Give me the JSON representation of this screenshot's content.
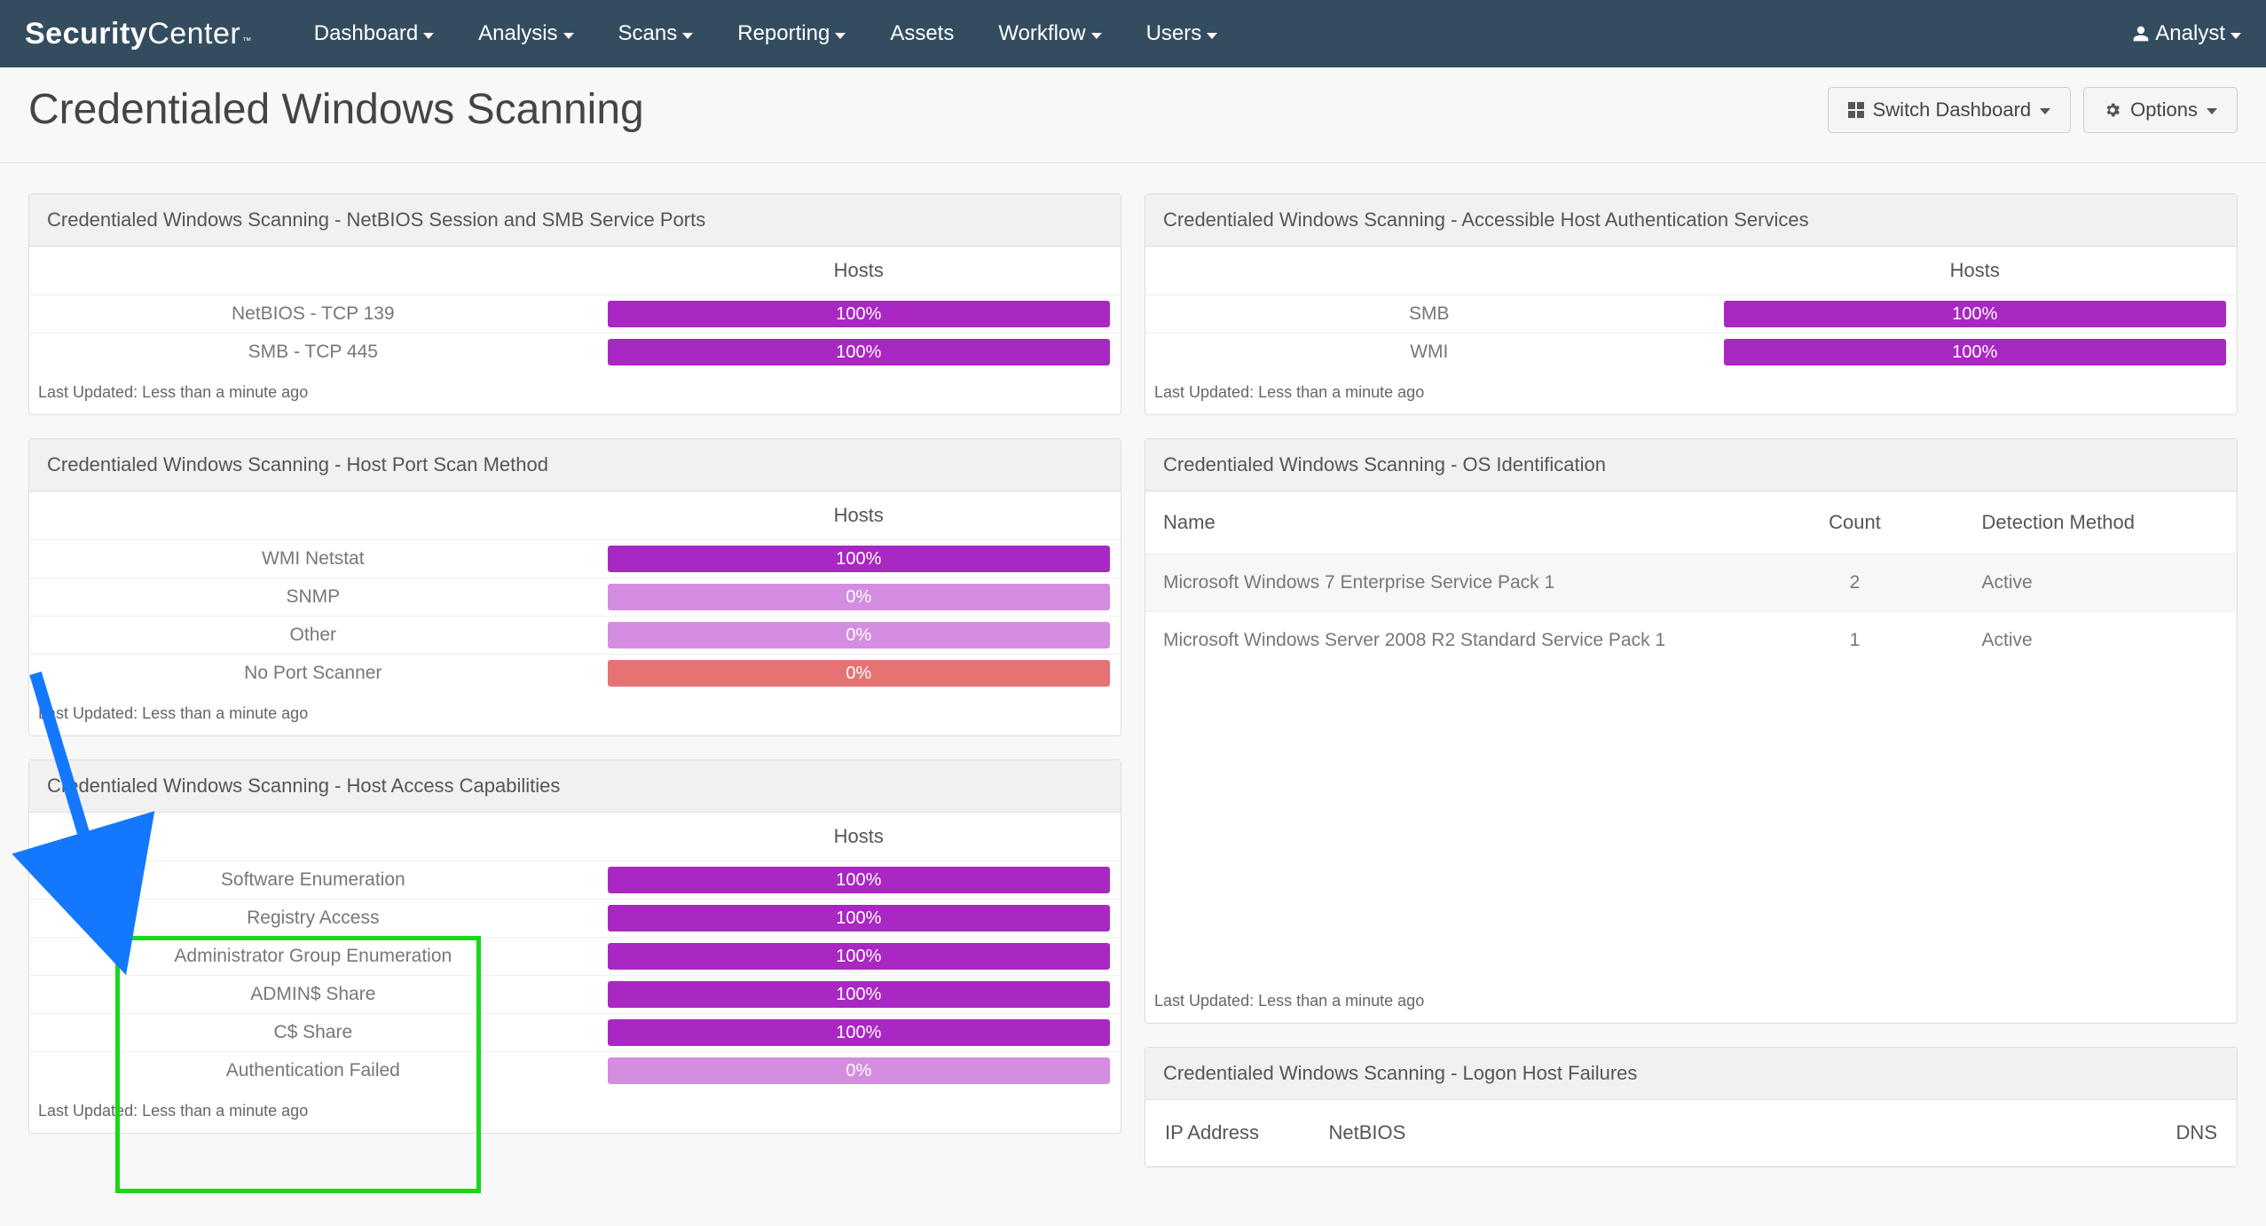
{
  "brand": {
    "part1": "Security",
    "part2": "Center",
    "tm": "™"
  },
  "nav": {
    "items": [
      {
        "label": "Dashboard",
        "caret": true
      },
      {
        "label": "Analysis",
        "caret": true
      },
      {
        "label": "Scans",
        "caret": true
      },
      {
        "label": "Reporting",
        "caret": true
      },
      {
        "label": "Assets",
        "caret": false
      },
      {
        "label": "Workflow",
        "caret": true
      },
      {
        "label": "Users",
        "caret": true
      }
    ],
    "userLabel": "Analyst"
  },
  "page": {
    "title": "Credentialed Windows Scanning",
    "switchBtn": "Switch Dashboard",
    "optionsBtn": "Options"
  },
  "footerText": "Last Updated: Less than a minute ago",
  "panels": {
    "netbios": {
      "title": "Credentialed Windows Scanning - NetBIOS Session and SMB Service Ports",
      "col": "Hosts",
      "rows": [
        {
          "label": "NetBIOS - TCP 139",
          "pct": "100%",
          "cls": "bar-purple"
        },
        {
          "label": "SMB - TCP 445",
          "pct": "100%",
          "cls": "bar-purple"
        }
      ]
    },
    "portscan": {
      "title": "Credentialed Windows Scanning - Host Port Scan Method",
      "col": "Hosts",
      "rows": [
        {
          "label": "WMI Netstat",
          "pct": "100%",
          "cls": "bar-purple"
        },
        {
          "label": "SNMP",
          "pct": "0%",
          "cls": "bar-lightpurple"
        },
        {
          "label": "Other",
          "pct": "0%",
          "cls": "bar-lightpurple"
        },
        {
          "label": "No Port Scanner",
          "pct": "0%",
          "cls": "bar-red"
        }
      ]
    },
    "access": {
      "title": "Credentialed Windows Scanning - Host Access Capabilities",
      "col": "Hosts",
      "rows": [
        {
          "label": "Software Enumeration",
          "pct": "100%",
          "cls": "bar-purple"
        },
        {
          "label": "Registry Access",
          "pct": "100%",
          "cls": "bar-purple"
        },
        {
          "label": "Administrator Group Enumeration",
          "pct": "100%",
          "cls": "bar-purple"
        },
        {
          "label": "ADMIN$ Share",
          "pct": "100%",
          "cls": "bar-purple"
        },
        {
          "label": "C$ Share",
          "pct": "100%",
          "cls": "bar-purple"
        },
        {
          "label": "Authentication Failed",
          "pct": "0%",
          "cls": "bar-lightpurple"
        }
      ]
    },
    "auth": {
      "title": "Credentialed Windows Scanning - Accessible Host Authentication Services",
      "col": "Hosts",
      "rows": [
        {
          "label": "SMB",
          "pct": "100%",
          "cls": "bar-purple"
        },
        {
          "label": "WMI",
          "pct": "100%",
          "cls": "bar-purple"
        }
      ]
    },
    "os": {
      "title": "Credentialed Windows Scanning - OS Identification",
      "cols": {
        "name": "Name",
        "count": "Count",
        "method": "Detection Method"
      },
      "rows": [
        {
          "name": "Microsoft Windows 7 Enterprise Service Pack 1",
          "count": "2",
          "method": "Active"
        },
        {
          "name": "Microsoft Windows Server 2008 R2 Standard Service Pack 1",
          "count": "1",
          "method": "Active"
        }
      ]
    },
    "logon": {
      "title": "Credentialed Windows Scanning - Logon Host Failures",
      "cols": {
        "ip": "IP Address",
        "netbios": "NetBIOS",
        "dns": "DNS"
      }
    }
  },
  "chart_data": [
    {
      "type": "bar",
      "title": "NetBIOS Session and SMB Service Ports",
      "categories": [
        "NetBIOS - TCP 139",
        "SMB - TCP 445"
      ],
      "values": [
        100,
        100
      ],
      "ylabel": "Hosts %",
      "ylim": [
        0,
        100
      ]
    },
    {
      "type": "bar",
      "title": "Host Port Scan Method",
      "categories": [
        "WMI Netstat",
        "SNMP",
        "Other",
        "No Port Scanner"
      ],
      "values": [
        100,
        0,
        0,
        0
      ],
      "ylabel": "Hosts %",
      "ylim": [
        0,
        100
      ]
    },
    {
      "type": "bar",
      "title": "Host Access Capabilities",
      "categories": [
        "Software Enumeration",
        "Registry Access",
        "Administrator Group Enumeration",
        "ADMIN$ Share",
        "C$ Share",
        "Authentication Failed"
      ],
      "values": [
        100,
        100,
        100,
        100,
        100,
        0
      ],
      "ylabel": "Hosts %",
      "ylim": [
        0,
        100
      ]
    },
    {
      "type": "bar",
      "title": "Accessible Host Authentication Services",
      "categories": [
        "SMB",
        "WMI"
      ],
      "values": [
        100,
        100
      ],
      "ylabel": "Hosts %",
      "ylim": [
        0,
        100
      ]
    },
    {
      "type": "table",
      "title": "OS Identification",
      "columns": [
        "Name",
        "Count",
        "Detection Method"
      ],
      "rows": [
        [
          "Microsoft Windows 7 Enterprise Service Pack 1",
          2,
          "Active"
        ],
        [
          "Microsoft Windows Server 2008 R2 Standard Service Pack 1",
          1,
          "Active"
        ]
      ]
    }
  ]
}
